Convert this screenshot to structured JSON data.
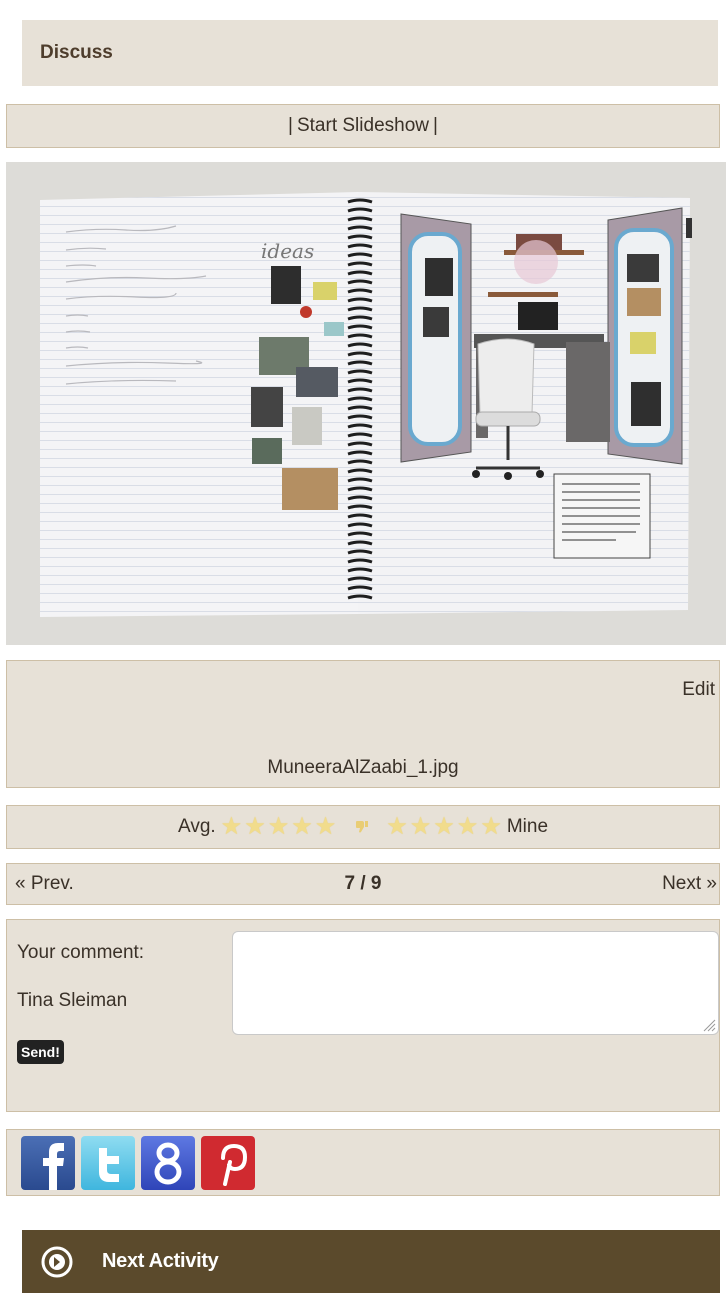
{
  "section": {
    "title": "Discuss"
  },
  "slideshow": {
    "prefix": "|",
    "label": "Start Slideshow",
    "suffix": "|"
  },
  "photo": {
    "alt": "Notebook collage of an office design",
    "handwriting_title": "ideas"
  },
  "file": {
    "edit_label": "Edit",
    "name": "MuneeraAlZaabi_1.jpg"
  },
  "rating": {
    "avg_label": "Avg.",
    "mine_label": "Mine",
    "avg_stars": 5,
    "mine_stars": 5,
    "star_color": "#f1dc8c"
  },
  "pager": {
    "prev_label": "« Prev.",
    "position": "7 / 9",
    "next_label": "Next »"
  },
  "comment": {
    "label": "Your comment:",
    "user": "Tina Sleiman",
    "value": "",
    "send_label": "Send!"
  },
  "share": {
    "buttons": [
      {
        "name": "facebook",
        "glyph": "f",
        "color": "#3b5998"
      },
      {
        "name": "twitter",
        "glyph": "t",
        "color": "#5bc6e8"
      },
      {
        "name": "google",
        "glyph": "8",
        "color": "#3f5bd4"
      },
      {
        "name": "pinterest",
        "glyph": "p",
        "color": "#cb2027"
      }
    ]
  },
  "next_activity": {
    "label": "Next Activity",
    "color": "#5b4a2c"
  }
}
